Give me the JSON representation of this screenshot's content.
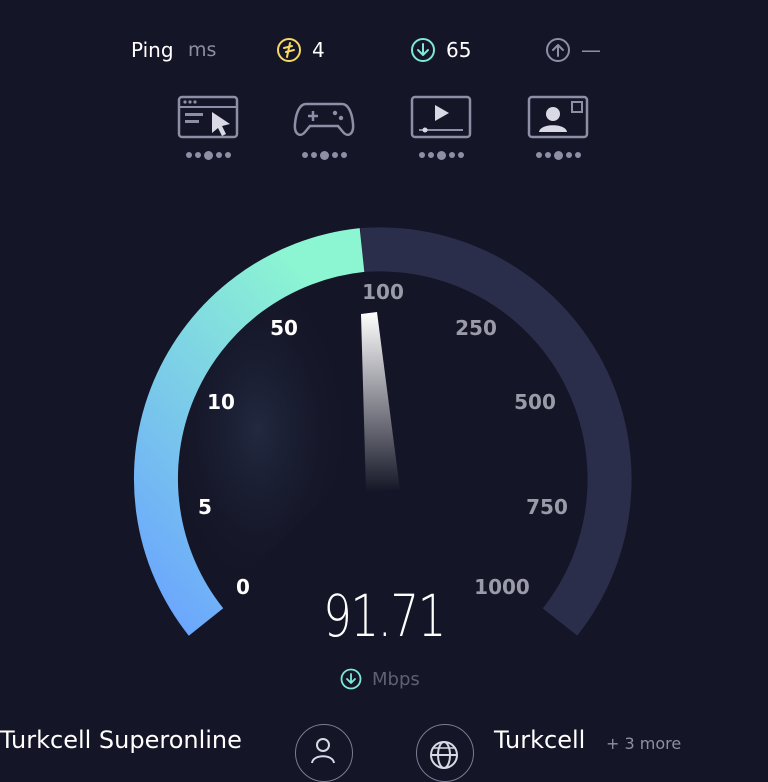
{
  "ping": {
    "label": "Ping",
    "unit": "ms",
    "jitter_value": "4",
    "download_value": "65",
    "upload_value": "—",
    "jitter_color": "#f5d865",
    "download_color": "#7fe9d4",
    "upload_color": "#8e8fa6"
  },
  "activities": [
    {
      "icon": "web-browsing-icon",
      "level": 3
    },
    {
      "icon": "gaming-icon",
      "level": 3
    },
    {
      "icon": "video-streaming-icon",
      "level": 3
    },
    {
      "icon": "video-call-icon",
      "level": 3
    }
  ],
  "gauge": {
    "ticks_left": [
      "0",
      "5",
      "10",
      "50"
    ],
    "ticks_top": "100",
    "ticks_right": [
      "250",
      "500",
      "750",
      "1000"
    ],
    "fill_start_color": "#6aa3ff",
    "fill_end_color": "#8cf5d2",
    "track_color": "#2b2e4a",
    "speed_value": "91.71",
    "unit": "Mbps"
  },
  "footer": {
    "isp": "Turkcell Superonline",
    "server": "Turkcell",
    "more": "+ 3 more"
  }
}
